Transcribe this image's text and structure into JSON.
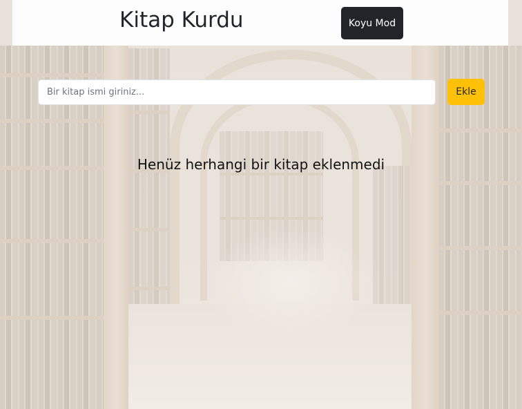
{
  "header": {
    "title": "Kitap Kurdu",
    "dark_mode_label": "Koyu Mod"
  },
  "form": {
    "book_input_placeholder": "Bir kitap ismi giriniz...",
    "book_input_value": "",
    "add_label": "Ekle"
  },
  "book_list": {
    "empty_message": "Henüz herhangi bir kitap eklenmedi",
    "items": []
  },
  "colors": {
    "header_bg": "#fdfdfd",
    "dark_button": "#212529",
    "add_button": "#ffc107"
  }
}
